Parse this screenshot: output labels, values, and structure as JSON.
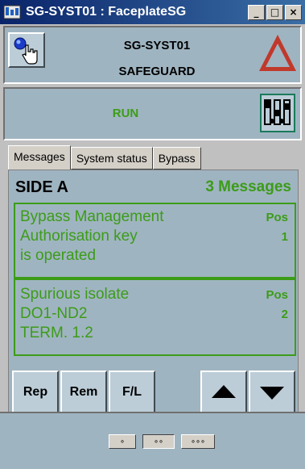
{
  "window": {
    "title": "SG-SYST01 : FaceplateSG",
    "minimize": "_",
    "maximize": "□",
    "close": "×"
  },
  "header": {
    "system_name": "SG-SYST01",
    "subtitle": "SAFEGUARD"
  },
  "state": {
    "label": "RUN"
  },
  "tabs": [
    {
      "label": "Messages",
      "active": true
    },
    {
      "label": "System status",
      "active": false
    },
    {
      "label": "Bypass",
      "active": false
    }
  ],
  "messages_panel": {
    "side": "SIDE A",
    "count_label": "3 Messages",
    "items": [
      {
        "lines": [
          "Bypass Management",
          "Authorisation key",
          "is operated"
        ],
        "pos_label": "Pos",
        "pos_value": "1"
      },
      {
        "lines": [
          "Spurious isolate",
          "DO1-ND2",
          "TERM. 1.2"
        ],
        "pos_label": "Pos",
        "pos_value": "2"
      }
    ]
  },
  "commands": {
    "rep": "Rep",
    "rem": "Rem",
    "fl": "F/L"
  },
  "pages": [
    {
      "label": "∘",
      "active": false
    },
    {
      "label": "∘∘",
      "active": true
    },
    {
      "label": "∘∘∘",
      "active": false
    }
  ],
  "colors": {
    "panel": "#9fb4c1",
    "accent_green": "#3c9c18",
    "alarm_red": "#c0392b"
  }
}
